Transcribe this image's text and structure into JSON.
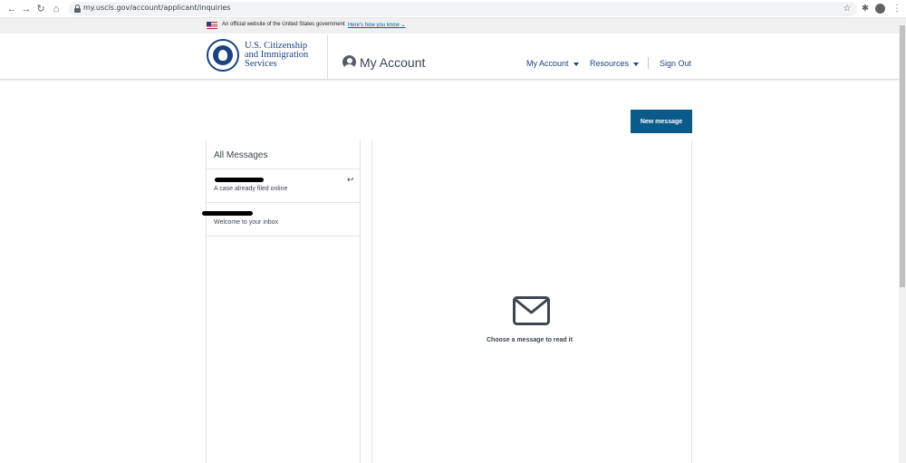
{
  "browser": {
    "url": "my.uscis.gov/account/applicant/inquiries"
  },
  "gov_banner": {
    "text": "An official website of the United States government",
    "link": "Here's how you know"
  },
  "header": {
    "agency_line1": "U.S. Citizenship",
    "agency_line2": "and Immigration",
    "agency_line3": "Services",
    "title": "My Account",
    "nav": {
      "my_account": "My Account",
      "resources": "Resources",
      "sign_out": "Sign Out"
    }
  },
  "main": {
    "new_message_label": "New message",
    "list_title": "All Messages",
    "messages": [
      {
        "subject": "A case already filed online"
      },
      {
        "subject": "Welcome to your inbox"
      }
    ],
    "empty_state": "Choose a message to read it"
  },
  "colors": {
    "brand_navy": "#1a4480",
    "button_blue": "#0b5a8c",
    "link_blue": "#005ea2"
  }
}
